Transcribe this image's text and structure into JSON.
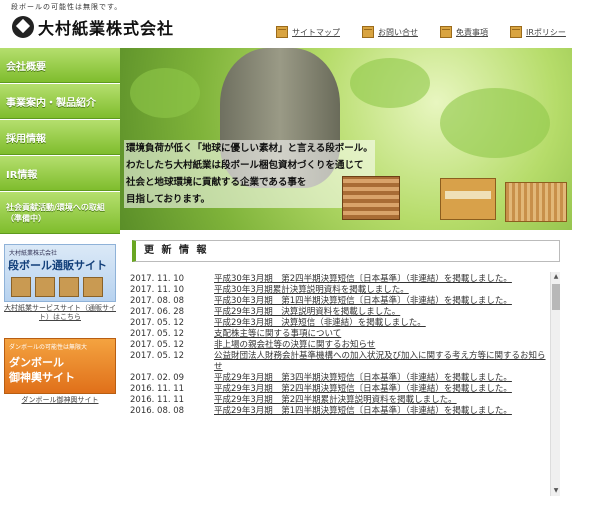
{
  "header": {
    "tagline": "段ボールの可能性は無限です。",
    "logo_text": "大村紙業株式会社",
    "links": [
      {
        "label": "サイトマップ",
        "icon": "box-icon"
      },
      {
        "label": "お問い合せ",
        "icon": "box-icon"
      },
      {
        "label": "免責事項",
        "icon": "box-icon"
      },
      {
        "label": "IRポリシー",
        "icon": "box-icon"
      }
    ]
  },
  "sidebar": {
    "items": [
      {
        "label": "会社概要"
      },
      {
        "label": "事業案内・製品紹介"
      },
      {
        "label": "採用情報"
      },
      {
        "label": "IR情報"
      },
      {
        "label": "社会貢献活動/環境への取組（準備中）"
      }
    ],
    "banner1": {
      "small": "大村紙業株式会社",
      "big": "段ボール通販サイト",
      "caption": "大村紙業サービスサイト（通販サイト）はこちら"
    },
    "banner2": {
      "small": "ダンボールの可能性は無限大",
      "big1": "ダンボール",
      "big2": "御神輿サイト",
      "caption": "ダンボール御神輿サイト"
    }
  },
  "hero": {
    "lines": [
      "環境負荷が低く「地球に優しい素材」と言える段ボール。",
      "わたしたち大村紙業は段ボール梱包資材づくりを通じて",
      "社会と地球環境に貢献する企業である事を",
      "目指しております。"
    ]
  },
  "news": {
    "title": "更 新 情 報",
    "items": [
      {
        "date": "2017. 11. 10",
        "text": "平成30年3月期　第2四半期決算短信〔日本基準〕（非連結）を掲載しました。"
      },
      {
        "date": "2017. 11. 10",
        "text": "平成30年3月期累計決算説明資料を掲載しました。"
      },
      {
        "date": "2017. 08. 08",
        "text": "平成30年3月期　第1四半期決算短信〔日本基準〕（非連結）を掲載しました。"
      },
      {
        "date": "2017. 06. 28",
        "text": "平成29年3月期　決算説明資料を掲載しました。"
      },
      {
        "date": "2017. 05. 12",
        "text": "平成29年3月期　決算短信（非連結）を掲載しました。"
      },
      {
        "date": "2017. 05. 12",
        "text": "支配株主等に関する事項について"
      },
      {
        "date": "2017. 05. 12",
        "text": "非上場の親会社等の決算に関するお知らせ"
      },
      {
        "date": "2017. 05. 12",
        "text": "公益財団法人財務会計基準機構への加入状況及び加入に関する考え方等に関するお知らせ"
      },
      {
        "date": "2017. 02. 09",
        "text": "平成29年3月期　第3四半期決算短信〔日本基準〕（非連結）を掲載しました。"
      },
      {
        "date": "2016. 11. 11",
        "text": "平成29年3月期　第2四半期決算短信〔日本基準〕（非連結）を掲載しました。"
      },
      {
        "date": "2016. 11. 11",
        "text": "平成29年3月期　第2四半期累計決算説明資料を掲載しました。"
      },
      {
        "date": "2016. 08. 08",
        "text": "平成29年3月期　第1四半期決算短信〔日本基準〕（非連結）を掲載しました。"
      }
    ]
  }
}
